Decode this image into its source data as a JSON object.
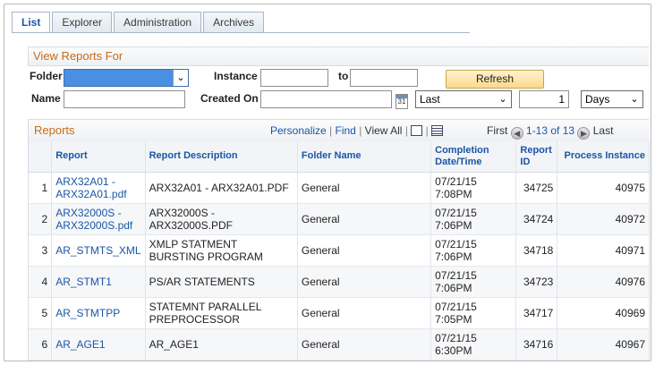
{
  "tabs": [
    {
      "label": "List",
      "active": true
    },
    {
      "label": "Explorer",
      "active": false
    },
    {
      "label": "Administration",
      "active": false
    },
    {
      "label": "Archives",
      "active": false
    }
  ],
  "filter": {
    "title": "View Reports For",
    "folder_label": "Folder",
    "folder_value": "",
    "instance_label": "Instance",
    "instance_from": "",
    "to_label": "to",
    "instance_to": "",
    "refresh_label": "Refresh",
    "name_label": "Name",
    "name_value": "",
    "created_on_label": "Created On",
    "created_on_value": "",
    "period_value": "Last",
    "period_count": "1",
    "period_unit": "Days"
  },
  "grid": {
    "title": "Reports",
    "personalize": "Personalize",
    "find": "Find",
    "view_all": "View All",
    "first": "First",
    "range": "1-13 of 13",
    "last": "Last",
    "columns": {
      "report": "Report",
      "description": "Report Description",
      "folder": "Folder Name",
      "completion": "Completion Date/Time",
      "report_id": "Report ID",
      "process_instance": "Process Instance"
    },
    "rows": [
      {
        "n": "1",
        "report": "ARX32A01 - ARX32A01.pdf",
        "description": "ARX32A01 - ARX32A01.PDF",
        "folder": "General",
        "completion": "07/21/15 7:08PM",
        "report_id": "34725",
        "process_instance": "40975"
      },
      {
        "n": "2",
        "report": "ARX32000S - ARX32000S.pdf",
        "description": "ARX32000S - ARX32000S.PDF",
        "folder": "General",
        "completion": "07/21/15 7:06PM",
        "report_id": "34724",
        "process_instance": "40972"
      },
      {
        "n": "3",
        "report": "AR_STMTS_XML",
        "description": "XMLP STATMENT BURSTING PROGRAM",
        "folder": "General",
        "completion": "07/21/15 7:06PM",
        "report_id": "34718",
        "process_instance": "40971"
      },
      {
        "n": "4",
        "report": "AR_STMT1",
        "description": "PS/AR STATEMENTS",
        "folder": "General",
        "completion": "07/21/15 7:06PM",
        "report_id": "34723",
        "process_instance": "40976"
      },
      {
        "n": "5",
        "report": "AR_STMTPP",
        "description": "STATEMNT PARALLEL PREPROCESSOR",
        "folder": "General",
        "completion": "07/21/15 7:05PM",
        "report_id": "34717",
        "process_instance": "40969"
      },
      {
        "n": "6",
        "report": "AR_AGE1",
        "description": "AR_AGE1",
        "folder": "General",
        "completion": "07/21/15 6:30PM",
        "report_id": "34716",
        "process_instance": "40967"
      }
    ]
  }
}
